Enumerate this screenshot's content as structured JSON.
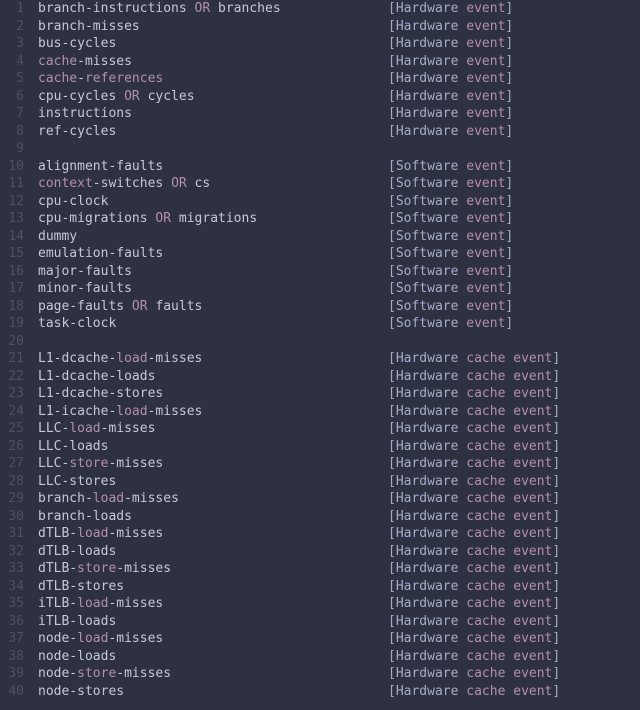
{
  "colors": {
    "bg": "#2d3142",
    "fg": "#c5c8d6",
    "accent": "#b48ead",
    "dim": "#4b5166"
  },
  "label_col_ch": 47,
  "lines": [
    {
      "n": 1,
      "tokens": [
        [
          "plain",
          "branch-instructions "
        ],
        [
          "kw",
          "OR"
        ],
        [
          "plain",
          " branches"
        ]
      ],
      "label": [
        "[Hardware ",
        {
          "kw": "event"
        },
        "]"
      ]
    },
    {
      "n": 2,
      "tokens": [
        [
          "plain",
          "branch-misses"
        ]
      ],
      "label": [
        "[Hardware ",
        {
          "kw": "event"
        },
        "]"
      ]
    },
    {
      "n": 3,
      "tokens": [
        [
          "plain",
          "bus-cycles"
        ]
      ],
      "label": [
        "[Hardware ",
        {
          "kw": "event"
        },
        "]"
      ]
    },
    {
      "n": 4,
      "tokens": [
        [
          "ident",
          "cache"
        ],
        [
          "plain",
          "-misses"
        ]
      ],
      "label": [
        "[Hardware ",
        {
          "kw": "event"
        },
        "]"
      ]
    },
    {
      "n": 5,
      "tokens": [
        [
          "ident",
          "cache"
        ],
        [
          "plain",
          "-"
        ],
        [
          "ident",
          "references"
        ]
      ],
      "label": [
        "[Hardware ",
        {
          "kw": "event"
        },
        "]"
      ]
    },
    {
      "n": 6,
      "tokens": [
        [
          "plain",
          "cpu-cycles "
        ],
        [
          "kw",
          "OR"
        ],
        [
          "plain",
          " cycles"
        ]
      ],
      "label": [
        "[Hardware ",
        {
          "kw": "event"
        },
        "]"
      ]
    },
    {
      "n": 7,
      "tokens": [
        [
          "plain",
          "instructions"
        ]
      ],
      "label": [
        "[Hardware ",
        {
          "kw": "event"
        },
        "]"
      ]
    },
    {
      "n": 8,
      "tokens": [
        [
          "plain",
          "ref-cycles"
        ]
      ],
      "label": [
        "[Hardware ",
        {
          "kw": "event"
        },
        "]"
      ]
    },
    {
      "n": 9,
      "tokens": [],
      "label": null
    },
    {
      "n": 10,
      "tokens": [
        [
          "plain",
          "alignment-faults"
        ]
      ],
      "label": [
        "[Software ",
        {
          "kw": "event"
        },
        "]"
      ]
    },
    {
      "n": 11,
      "tokens": [
        [
          "ident",
          "context"
        ],
        [
          "plain",
          "-switches "
        ],
        [
          "kw",
          "OR"
        ],
        [
          "plain",
          " cs"
        ]
      ],
      "label": [
        "[Software ",
        {
          "kw": "event"
        },
        "]"
      ]
    },
    {
      "n": 12,
      "tokens": [
        [
          "plain",
          "cpu-clock"
        ]
      ],
      "label": [
        "[Software ",
        {
          "kw": "event"
        },
        "]"
      ]
    },
    {
      "n": 13,
      "tokens": [
        [
          "plain",
          "cpu-migrations "
        ],
        [
          "kw",
          "OR"
        ],
        [
          "plain",
          " migrations"
        ]
      ],
      "label": [
        "[Software ",
        {
          "kw": "event"
        },
        "]"
      ]
    },
    {
      "n": 14,
      "tokens": [
        [
          "plain",
          "dummy"
        ]
      ],
      "label": [
        "[Software ",
        {
          "kw": "event"
        },
        "]"
      ]
    },
    {
      "n": 15,
      "tokens": [
        [
          "plain",
          "emulation-faults"
        ]
      ],
      "label": [
        "[Software ",
        {
          "kw": "event"
        },
        "]"
      ]
    },
    {
      "n": 16,
      "tokens": [
        [
          "plain",
          "major-faults"
        ]
      ],
      "label": [
        "[Software ",
        {
          "kw": "event"
        },
        "]"
      ]
    },
    {
      "n": 17,
      "tokens": [
        [
          "plain",
          "minor-faults"
        ]
      ],
      "label": [
        "[Software ",
        {
          "kw": "event"
        },
        "]"
      ]
    },
    {
      "n": 18,
      "tokens": [
        [
          "plain",
          "page-faults "
        ],
        [
          "kw",
          "OR"
        ],
        [
          "plain",
          " faults"
        ]
      ],
      "label": [
        "[Software ",
        {
          "kw": "event"
        },
        "]"
      ]
    },
    {
      "n": 19,
      "tokens": [
        [
          "plain",
          "task-clock"
        ]
      ],
      "label": [
        "[Software ",
        {
          "kw": "event"
        },
        "]"
      ]
    },
    {
      "n": 20,
      "tokens": [],
      "label": null
    },
    {
      "n": 21,
      "tokens": [
        [
          "plain",
          "L1-dcache-"
        ],
        [
          "ident",
          "load"
        ],
        [
          "plain",
          "-misses"
        ]
      ],
      "label": [
        "[Hardware ",
        {
          "kw": "cache event"
        },
        "]"
      ]
    },
    {
      "n": 22,
      "tokens": [
        [
          "plain",
          "L1-dcache-loads"
        ]
      ],
      "label": [
        "[Hardware ",
        {
          "kw": "cache event"
        },
        "]"
      ]
    },
    {
      "n": 23,
      "tokens": [
        [
          "plain",
          "L1-dcache-stores"
        ]
      ],
      "label": [
        "[Hardware ",
        {
          "kw": "cache event"
        },
        "]"
      ]
    },
    {
      "n": 24,
      "tokens": [
        [
          "plain",
          "L1-icache-"
        ],
        [
          "ident",
          "load"
        ],
        [
          "plain",
          "-misses"
        ]
      ],
      "label": [
        "[Hardware ",
        {
          "kw": "cache event"
        },
        "]"
      ]
    },
    {
      "n": 25,
      "tokens": [
        [
          "plain",
          "LLC-"
        ],
        [
          "ident",
          "load"
        ],
        [
          "plain",
          "-misses"
        ]
      ],
      "label": [
        "[Hardware ",
        {
          "kw": "cache event"
        },
        "]"
      ]
    },
    {
      "n": 26,
      "tokens": [
        [
          "plain",
          "LLC-loads"
        ]
      ],
      "label": [
        "[Hardware ",
        {
          "kw": "cache event"
        },
        "]"
      ]
    },
    {
      "n": 27,
      "tokens": [
        [
          "plain",
          "LLC-"
        ],
        [
          "ident",
          "store"
        ],
        [
          "plain",
          "-misses"
        ]
      ],
      "label": [
        "[Hardware ",
        {
          "kw": "cache event"
        },
        "]"
      ]
    },
    {
      "n": 28,
      "tokens": [
        [
          "plain",
          "LLC-stores"
        ]
      ],
      "label": [
        "[Hardware ",
        {
          "kw": "cache event"
        },
        "]"
      ]
    },
    {
      "n": 29,
      "tokens": [
        [
          "plain",
          "branch-"
        ],
        [
          "ident",
          "load"
        ],
        [
          "plain",
          "-misses"
        ]
      ],
      "label": [
        "[Hardware ",
        {
          "kw": "cache event"
        },
        "]"
      ]
    },
    {
      "n": 30,
      "tokens": [
        [
          "plain",
          "branch-loads"
        ]
      ],
      "label": [
        "[Hardware ",
        {
          "kw": "cache event"
        },
        "]"
      ]
    },
    {
      "n": 31,
      "tokens": [
        [
          "plain",
          "dTLB-"
        ],
        [
          "ident",
          "load"
        ],
        [
          "plain",
          "-misses"
        ]
      ],
      "label": [
        "[Hardware ",
        {
          "kw": "cache event"
        },
        "]"
      ]
    },
    {
      "n": 32,
      "tokens": [
        [
          "plain",
          "dTLB-loads"
        ]
      ],
      "label": [
        "[Hardware ",
        {
          "kw": "cache event"
        },
        "]"
      ]
    },
    {
      "n": 33,
      "tokens": [
        [
          "plain",
          "dTLB-"
        ],
        [
          "ident",
          "store"
        ],
        [
          "plain",
          "-misses"
        ]
      ],
      "label": [
        "[Hardware ",
        {
          "kw": "cache event"
        },
        "]"
      ]
    },
    {
      "n": 34,
      "tokens": [
        [
          "plain",
          "dTLB-stores"
        ]
      ],
      "label": [
        "[Hardware ",
        {
          "kw": "cache event"
        },
        "]"
      ]
    },
    {
      "n": 35,
      "tokens": [
        [
          "plain",
          "iTLB-"
        ],
        [
          "ident",
          "load"
        ],
        [
          "plain",
          "-misses"
        ]
      ],
      "label": [
        "[Hardware ",
        {
          "kw": "cache event"
        },
        "]"
      ]
    },
    {
      "n": 36,
      "tokens": [
        [
          "plain",
          "iTLB-loads"
        ]
      ],
      "label": [
        "[Hardware ",
        {
          "kw": "cache event"
        },
        "]"
      ]
    },
    {
      "n": 37,
      "tokens": [
        [
          "plain",
          "node-"
        ],
        [
          "ident",
          "load"
        ],
        [
          "plain",
          "-misses"
        ]
      ],
      "label": [
        "[Hardware ",
        {
          "kw": "cache event"
        },
        "]"
      ]
    },
    {
      "n": 38,
      "tokens": [
        [
          "plain",
          "node-loads"
        ]
      ],
      "label": [
        "[Hardware ",
        {
          "kw": "cache event"
        },
        "]"
      ]
    },
    {
      "n": 39,
      "tokens": [
        [
          "plain",
          "node-"
        ],
        [
          "ident",
          "store"
        ],
        [
          "plain",
          "-misses"
        ]
      ],
      "label": [
        "[Hardware ",
        {
          "kw": "cache event"
        },
        "]"
      ]
    },
    {
      "n": 40,
      "tokens": [
        [
          "plain",
          "node-stores"
        ]
      ],
      "label": [
        "[Hardware ",
        {
          "kw": "cache event"
        },
        "]"
      ]
    }
  ]
}
